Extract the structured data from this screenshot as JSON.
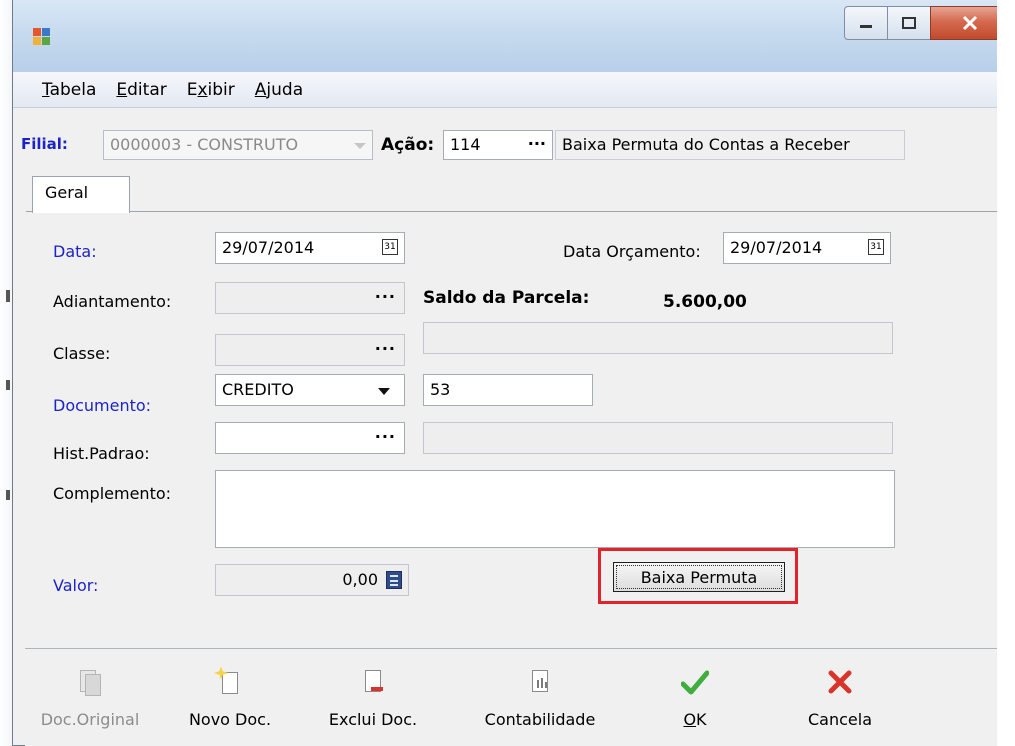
{
  "menu": {
    "items": [
      {
        "label": "Tabela",
        "mnemonic": "T",
        "rest": "abela"
      },
      {
        "label": "Editar",
        "mnemonic": "E",
        "rest": "ditar"
      },
      {
        "label": "Exibir",
        "mnemonic": "E",
        "rest": "xibir",
        "pre": ""
      },
      {
        "label": "Ajuda",
        "mnemonic": "A",
        "rest": "juda"
      }
    ]
  },
  "header": {
    "filial_label": "Filial:",
    "filial_value": "0000003 - CONSTRUTO",
    "acao_label": "Ação:",
    "acao_value": "114",
    "acao_desc": "Baixa Permuta do Contas a Receber",
    "lookup_dots": "···"
  },
  "tabs": [
    {
      "label": "Geral"
    }
  ],
  "form": {
    "data_label": "Data:",
    "data_value": "29/07/2014",
    "data_orc_label": "Data Orçamento:",
    "data_orc_value": "29/07/2014",
    "adiantamento_label": "Adiantamento:",
    "saldo_label": "Saldo da Parcela:",
    "saldo_value": "5.600,00",
    "classe_label": "Classe:",
    "documento_label": "Documento:",
    "documento_value": "CREDITO",
    "documento_numero": "53",
    "hist_label": "Hist.Padrao:",
    "complemento_label": "Complemento:",
    "complemento_value": "",
    "valor_label": "Valor:",
    "valor_value": "0,00",
    "baixa_button": "Baixa Permuta",
    "calendar_glyph": "31"
  },
  "toolbar": {
    "doc_original": "Doc.Original",
    "novo_doc": "Novo Doc.",
    "exclui_doc": "Exclui Doc.",
    "contabilidade": "Contabilidade",
    "ok": "OK",
    "cancela": "Cancela"
  },
  "colors": {
    "label_blue": "#1c24c6",
    "highlight_red": "#e0242b",
    "ok_green": "#3fae3f",
    "cancel_red": "#d9342b"
  }
}
